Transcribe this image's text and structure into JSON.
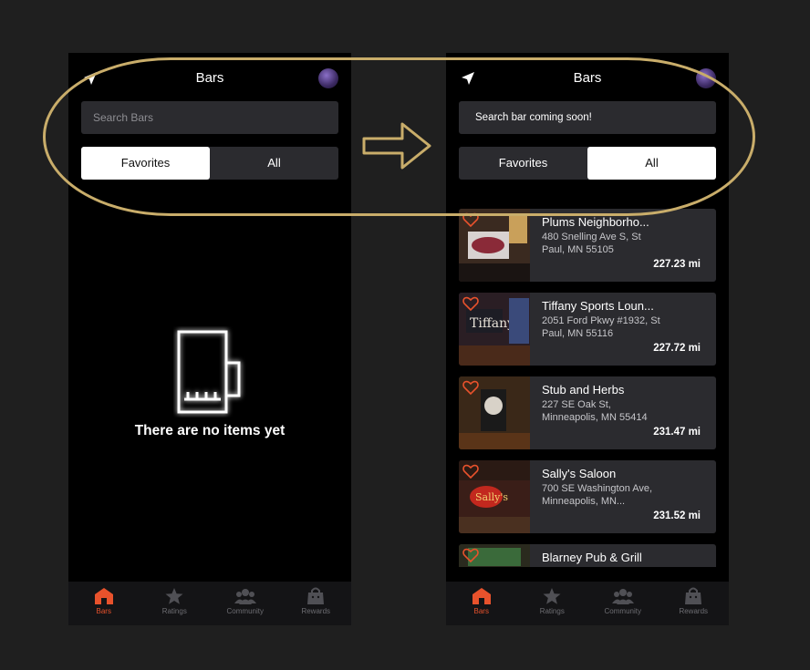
{
  "left_screen": {
    "header": {
      "title": "Bars",
      "send_icon": "send-icon",
      "avatar": "avatar"
    },
    "search": {
      "placeholder": "Search Bars"
    },
    "segmented": {
      "favorites": "Favorites",
      "all": "All",
      "active": "Favorites"
    },
    "empty_state": {
      "icon": "beer-mug-icon",
      "message": "There are no items yet"
    },
    "tabbar": [
      {
        "label": "Bars",
        "icon": "home-icon",
        "active": true
      },
      {
        "label": "Ratings",
        "icon": "star-icon",
        "active": false
      },
      {
        "label": "Community",
        "icon": "community-icon",
        "active": false
      },
      {
        "label": "Rewards",
        "icon": "bag-icon",
        "active": false
      }
    ]
  },
  "right_screen": {
    "header": {
      "title": "Bars",
      "send_icon": "send-icon",
      "avatar": "avatar"
    },
    "search": {
      "text": "Search bar coming soon!"
    },
    "segmented": {
      "favorites": "Favorites",
      "all": "All",
      "active": "All"
    },
    "bars": [
      {
        "name": "Plums Neighborho...",
        "address": "480 Snelling Ave S, St Paul, MN 55105",
        "distance": "227.23 mi"
      },
      {
        "name": "Tiffany Sports Loun...",
        "address": "2051 Ford Pkwy #1932, St Paul, MN 55116",
        "distance": "227.72 mi"
      },
      {
        "name": "Stub and Herbs",
        "address": "227 SE Oak St, Minneapolis, MN 55414",
        "distance": "231.47 mi"
      },
      {
        "name": "Sally's Saloon",
        "address": "700 SE Washington Ave, Minneapolis, MN...",
        "distance": "231.52 mi"
      },
      {
        "name": "Blarney Pub & Grill",
        "address": "",
        "distance": ""
      }
    ],
    "tabbar": [
      {
        "label": "Bars",
        "icon": "home-icon",
        "active": true
      },
      {
        "label": "Ratings",
        "icon": "star-icon",
        "active": false
      },
      {
        "label": "Community",
        "icon": "community-icon",
        "active": false
      },
      {
        "label": "Rewards",
        "icon": "bag-icon",
        "active": false
      }
    ]
  },
  "annotation": {
    "arrow_icon": "right-arrow-icon",
    "highlight": "header-highlight-oval"
  },
  "colors": {
    "background": "#1f1f1f",
    "accent": "#e8522c",
    "card": "#2b2b2f",
    "highlight": "#c9ad6a"
  }
}
